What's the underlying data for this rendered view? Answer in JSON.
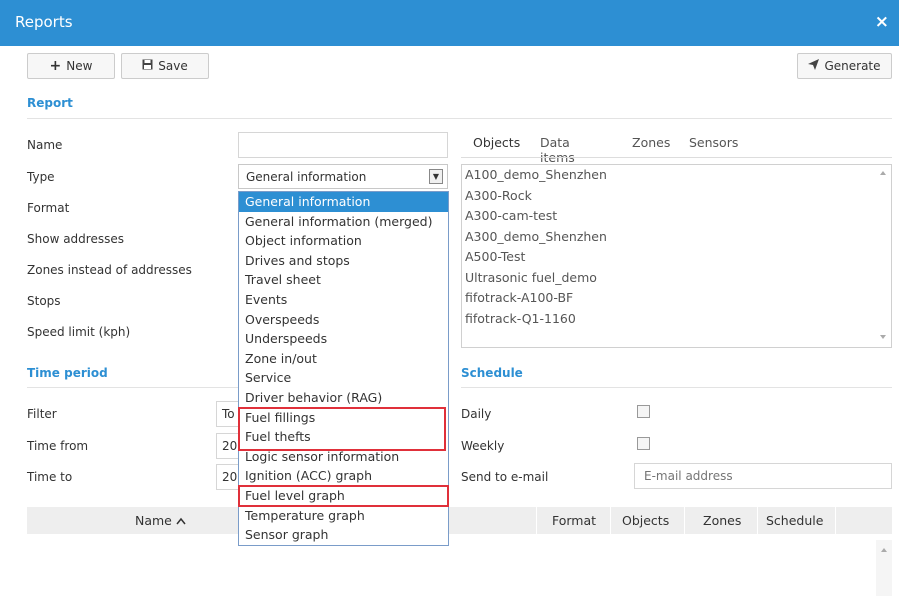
{
  "window": {
    "title": "Reports",
    "close_icon": "×"
  },
  "toolbar": {
    "new_label": "New",
    "save_label": "Save",
    "generate_label": "Generate"
  },
  "report": {
    "section_title": "Report",
    "labels": {
      "name": "Name",
      "type": "Type",
      "format": "Format",
      "show_addresses": "Show addresses",
      "zones_instead": "Zones instead of addresses",
      "stops": "Stops",
      "speed_limit": "Speed limit (kph)"
    },
    "type_value": "General information",
    "type_options": [
      "General information",
      "General information (merged)",
      "Object information",
      "Drives and stops",
      "Travel sheet",
      "Events",
      "Overspeeds",
      "Underspeeds",
      "Zone in/out",
      "Service",
      "Driver behavior (RAG)",
      "Fuel fillings",
      "Fuel thefts",
      "Logic sensor information",
      "Ignition (ACC) graph",
      "Fuel level graph",
      "Temperature graph",
      "Sensor graph"
    ]
  },
  "objects_panel": {
    "tabs": [
      "Objects",
      "Data items",
      "Zones",
      "Sensors"
    ],
    "items": [
      "A100_demo_Shenzhen",
      "A300-Rock",
      "A300-cam-test",
      "A300_demo_Shenzhen",
      "A500-Test",
      "Ultrasonic fuel_demo",
      "fifotrack-A100-BF",
      "fifotrack-Q1-1160"
    ]
  },
  "time_period": {
    "section_title": "Time period",
    "labels": {
      "filter": "Filter",
      "time_from": "Time from",
      "time_to": "Time to"
    },
    "filter_value_fragment": "To",
    "from_value_fragment": "20",
    "to_value_fragment": "20"
  },
  "schedule": {
    "section_title": "Schedule",
    "labels": {
      "daily": "Daily",
      "weekly": "Weekly",
      "send_to_email": "Send to e-mail"
    },
    "email_placeholder": "E-mail address",
    "daily_checked": false,
    "weekly_checked": false
  },
  "reports_table": {
    "columns": {
      "name": "Name",
      "format": "Format",
      "objects": "Objects",
      "zones": "Zones",
      "schedule": "Schedule"
    },
    "sort_indicator": "^"
  }
}
